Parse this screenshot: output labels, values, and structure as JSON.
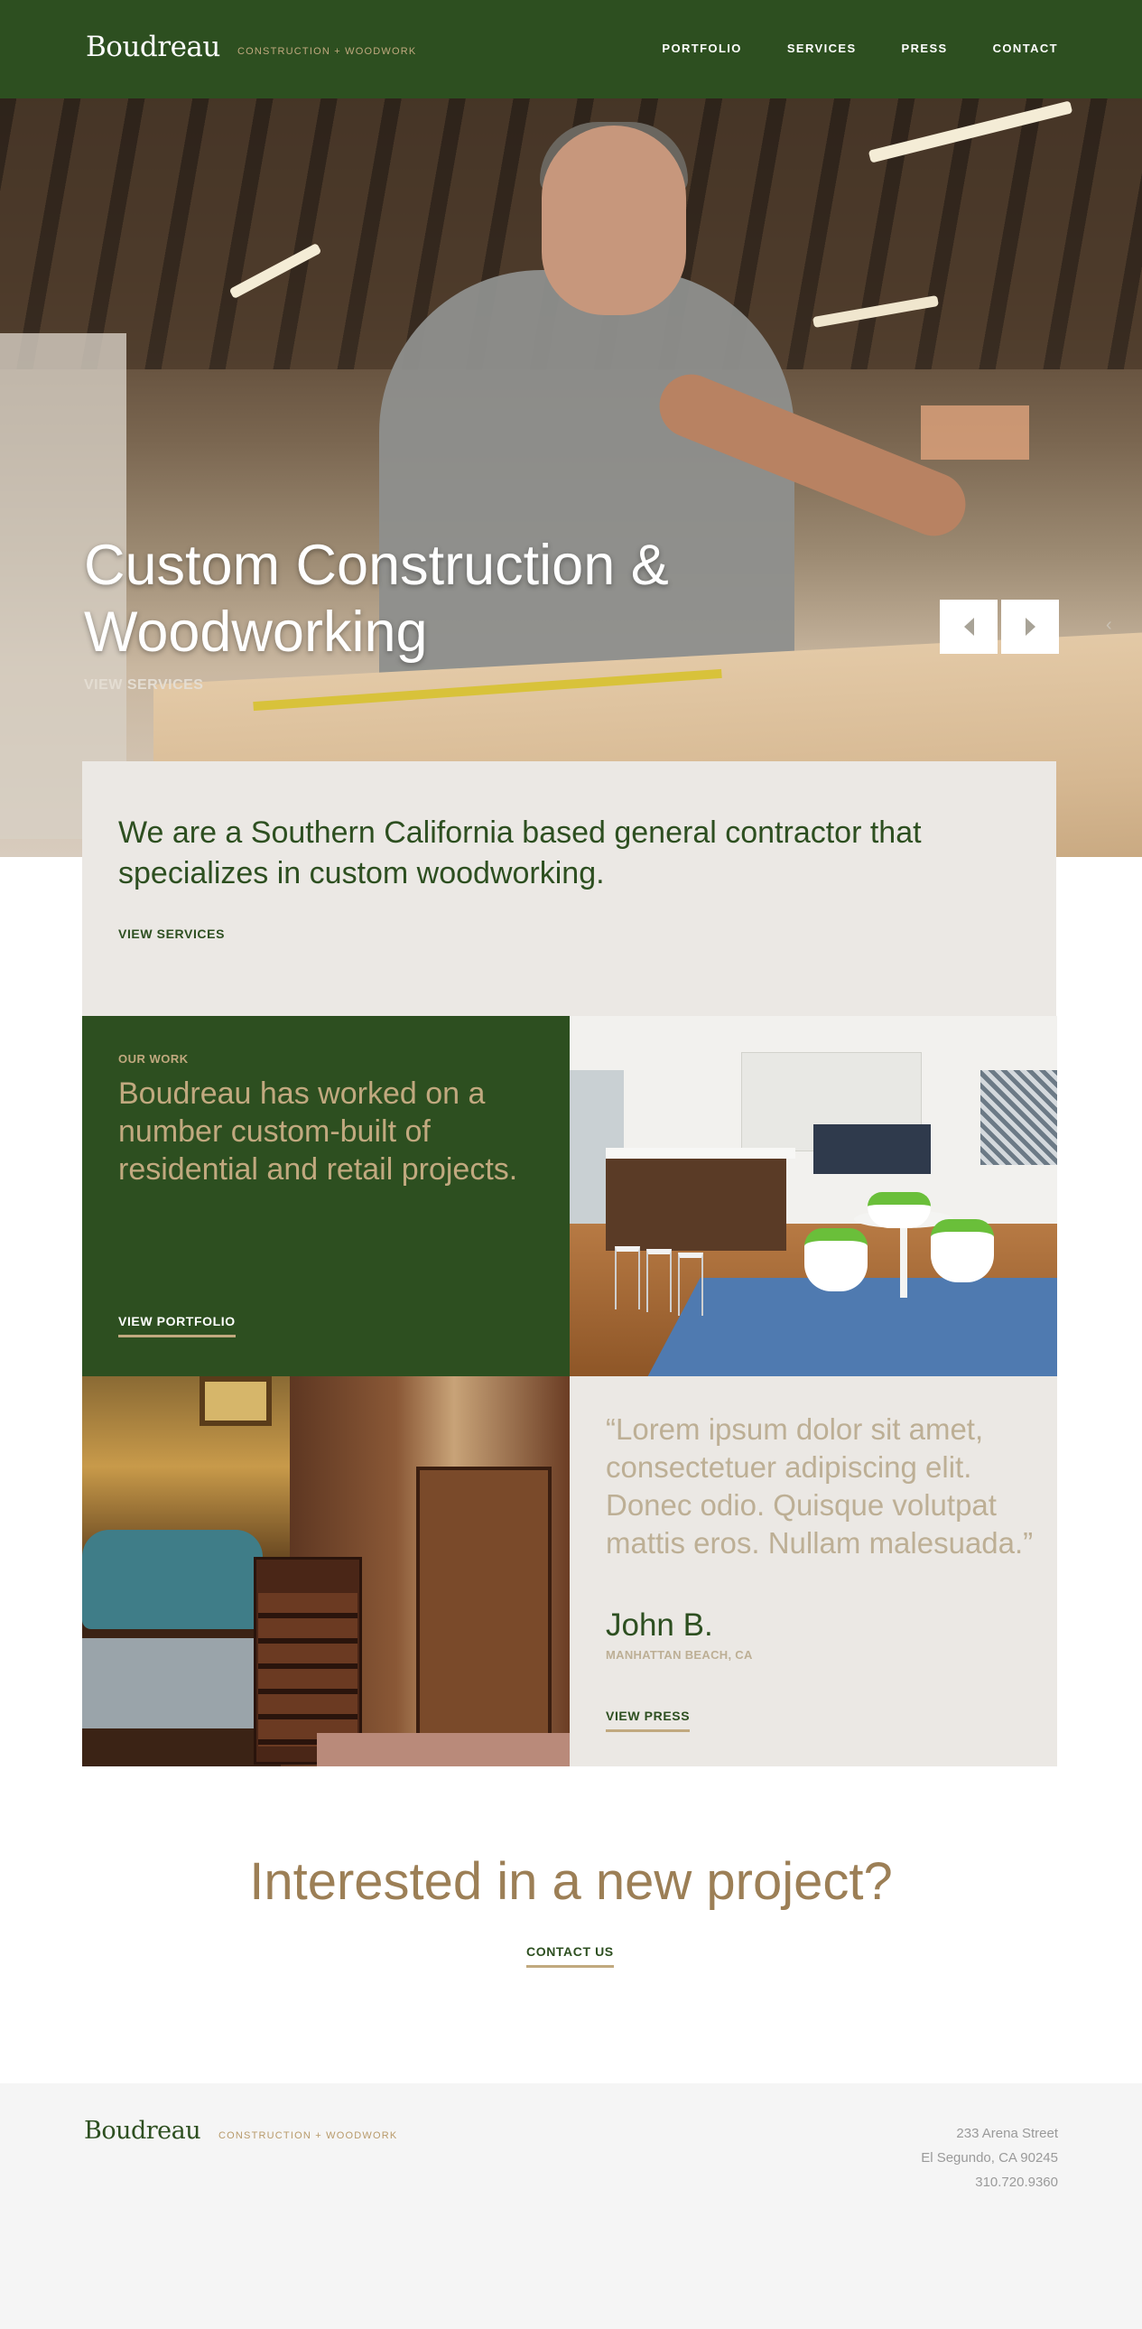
{
  "header": {
    "logo": "Boudreau",
    "tagline": "CONSTRUCTION + WOODWORK",
    "nav": [
      "PORTFOLIO",
      "SERVICES",
      "PRESS",
      "CONTACT"
    ]
  },
  "hero": {
    "title": "Custom Construction & Woodworking",
    "link": "VIEW SERVICES",
    "edge_chevron": "‹"
  },
  "intro": {
    "text": "We are a Southern California based general contractor that specializes in custom woodworking.",
    "link": "VIEW SERVICES"
  },
  "work": {
    "eyebrow": "OUR WORK",
    "text": "Boudreau has worked on a number custom-built of residential and retail projects.",
    "link": "VIEW PORTFOLIO"
  },
  "testimonial": {
    "quote": "“Lorem ipsum dolor sit amet, consectetuer adipiscing elit. Donec odio. Quisque volutpat mattis eros. Nullam malesuada.”",
    "name": "John B.",
    "location": "MANHATTAN BEACH, CA",
    "link": "VIEW PRESS"
  },
  "cta": {
    "title": "Interested in a new project?",
    "link": "CONTACT US"
  },
  "footer": {
    "logo": "Boudreau",
    "tagline": "CONSTRUCTION + WOODWORK",
    "address_line1": "233 Arena Street",
    "address_line2": "El Segundo, CA 90245",
    "phone": "310.720.9360"
  },
  "colors": {
    "brand_green": "#2d4f20",
    "accent_tan": "#c1a97f",
    "panel_beige": "#ebe8e4"
  },
  "icons": {
    "prev": "chevron-left-icon",
    "next": "chevron-right-icon"
  }
}
